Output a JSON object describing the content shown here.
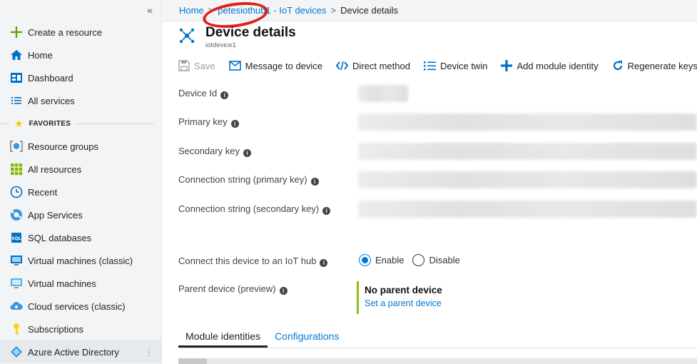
{
  "sidebar": {
    "collapse_glyph": "«",
    "favorites_label": "FAVORITES",
    "items": [
      {
        "label": "Create a resource",
        "icon": "plus-icon"
      },
      {
        "label": "Home",
        "icon": "home-icon"
      },
      {
        "label": "Dashboard",
        "icon": "dashboard-icon"
      },
      {
        "label": "All services",
        "icon": "list-icon"
      },
      {
        "label": "Resource groups",
        "icon": "resource-groups-icon"
      },
      {
        "label": "All resources",
        "icon": "all-resources-icon"
      },
      {
        "label": "Recent",
        "icon": "clock-icon"
      },
      {
        "label": "App Services",
        "icon": "app-services-icon"
      },
      {
        "label": "SQL databases",
        "icon": "sql-icon"
      },
      {
        "label": "Virtual machines (classic)",
        "icon": "vm-classic-icon"
      },
      {
        "label": "Virtual machines",
        "icon": "vm-icon"
      },
      {
        "label": "Cloud services (classic)",
        "icon": "cloud-services-icon"
      },
      {
        "label": "Subscriptions",
        "icon": "key-icon"
      },
      {
        "label": "Azure Active Directory",
        "icon": "aad-icon"
      }
    ]
  },
  "breadcrumb": {
    "home": "Home",
    "hub": "petesiothub1 - IoT devices",
    "current": "Device details"
  },
  "header": {
    "title": "Device details",
    "subtitle": "iotdevice1"
  },
  "toolbar": {
    "save": "Save",
    "message": "Message to device",
    "direct_method": "Direct method",
    "device_twin": "Device twin",
    "add_module": "Add module identity",
    "regenerate": "Regenerate keys"
  },
  "fields": {
    "device_id": "Device Id",
    "primary_key": "Primary key",
    "secondary_key": "Secondary key",
    "conn_primary": "Connection string (primary key)",
    "conn_secondary": "Connection string (secondary key)",
    "connect_hub": "Connect this device to an IoT hub",
    "parent_device": "Parent device (preview)"
  },
  "connect_options": {
    "enable": "Enable",
    "disable": "Disable",
    "selected": "Enable"
  },
  "parent": {
    "name": "No parent device",
    "link": "Set a parent device"
  },
  "tabs": {
    "module_identities": "Module identities",
    "configurations": "Configurations"
  },
  "colors": {
    "accent": "#0078d4",
    "annotation": "#e0201b",
    "parent_bar": "#8cbd18"
  }
}
